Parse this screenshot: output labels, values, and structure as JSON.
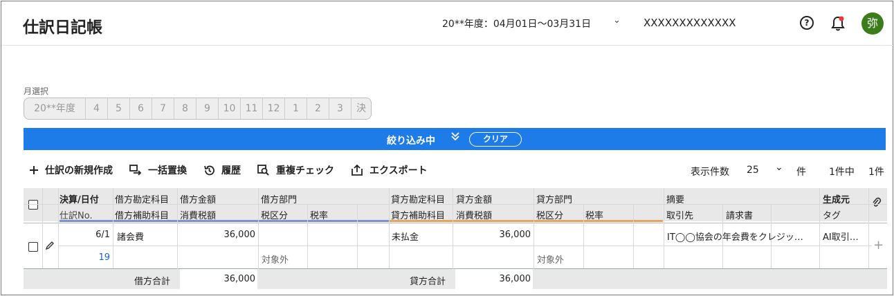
{
  "header": {
    "title": "仕訳日記帳",
    "fiscal_year": "20**年度：04月01日〜03月31日",
    "company": "XXXXXXXXXXXXX",
    "help_symbol": "?",
    "avatar_text": "弥",
    "avatar_color": "#3a7d1a",
    "notification_dot_color": "#e8373e"
  },
  "month_select": {
    "label": "月選択",
    "items": [
      "20**年度",
      "4",
      "5",
      "6",
      "7",
      "8",
      "9",
      "10",
      "11",
      "12",
      "1",
      "2",
      "3",
      "決"
    ]
  },
  "filter": {
    "label": "絞り込み中",
    "clear_label": "クリア",
    "bar_color": "#1e7ce8"
  },
  "toolbar": {
    "new_entry": "仕訳の新規作成",
    "bulk_replace": "一括置換",
    "history": "履歴",
    "duplicate_check": "重複チェック",
    "export": "エクスポート"
  },
  "pager": {
    "per_page_label": "表示件数",
    "per_page_value": "25",
    "unit": "件",
    "count": "1件中",
    "total": "1件"
  },
  "table": {
    "headers_top": {
      "date": "決算/日付",
      "debit_account": "借方勘定科目",
      "debit_amount": "借方金額",
      "debit_dept": "借方部門",
      "credit_account": "貸方勘定科目",
      "credit_amount": "貸方金額",
      "credit_dept": "貸方部門",
      "memo": "摘要",
      "origin": "生成元"
    },
    "headers_bottom": {
      "entry_no": "仕訳No.",
      "debit_sub": "借方補助科目",
      "debit_tax": "消費税額",
      "debit_tax_cat": "税区分",
      "debit_tax_rate": "税率",
      "credit_sub": "貸方補助科目",
      "credit_tax": "消費税額",
      "credit_tax_cat": "税区分",
      "credit_tax_rate": "税率",
      "partner": "取引先",
      "invoice": "請求書",
      "tag": "タグ"
    },
    "row": {
      "date": "6/1",
      "entry_no": "19",
      "debit_account": "諸会費",
      "debit_amount": "36,000",
      "debit_tax_cat": "対象外",
      "credit_account": "未払金",
      "credit_amount": "36,000",
      "credit_tax_cat": "対象外",
      "memo": "IT◯◯協会の年会費をクレジッ…",
      "origin": "AI取引…",
      "add_symbol": "+"
    },
    "totals": {
      "debit_label": "借方合計",
      "debit_total": "36,000",
      "credit_label": "貸方合計",
      "credit_total": "36,000"
    },
    "accent_colors": {
      "debit": "#7b8fd4",
      "credit": "#e8a25a"
    }
  }
}
